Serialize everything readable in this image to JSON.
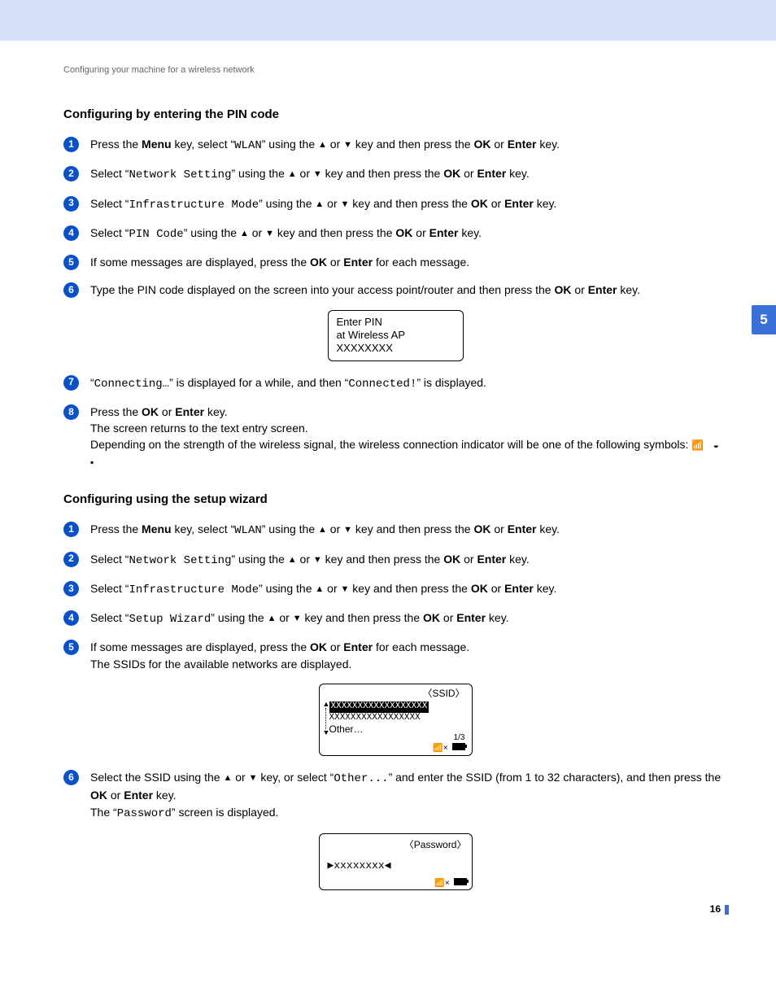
{
  "breadcrumb": "Configuring your machine for a wireless network",
  "chapter_tab": "5",
  "page_number": "16",
  "section_a": {
    "title": "Configuring by entering the PIN code",
    "steps": {
      "s1": {
        "pre": "Press the ",
        "b1": "Menu",
        "mid1": " key, select “",
        "mono": "WLAN",
        "mid2": "” using the ",
        "keys": " key and then press the ",
        "b2": "OK",
        "or": " or ",
        "b3": "Enter",
        "end": " key."
      },
      "s2": {
        "pre": "Select “",
        "mono": "Network Setting",
        "mid": "” using the ",
        "keys": " key and then press the ",
        "b2": "OK",
        "or": " or ",
        "b3": "Enter",
        "end": " key."
      },
      "s3": {
        "pre": "Select “",
        "mono": "Infrastructure Mode",
        "mid": "” using the ",
        "keys": " key and then press the ",
        "b2": "OK",
        "or": " or ",
        "b3": "Enter",
        "end": " key."
      },
      "s4": {
        "pre": "Select “",
        "mono": "PIN Code",
        "mid": "” using the ",
        "keys": " key and then press the ",
        "b2": "OK",
        "or": " or ",
        "b3": "Enter",
        "end": " key."
      },
      "s5": {
        "pre": "If some messages are displayed, press the ",
        "b2": "OK",
        "or": " or ",
        "b3": "Enter",
        "end": " for each message."
      },
      "s6": {
        "pre": "Type the PIN code displayed on the screen into your access point/router and then press the ",
        "b2": "OK",
        "or": " or ",
        "b3": "Enter",
        "end": " key."
      },
      "lcd1": {
        "l1": "Enter PIN",
        "l2": "at Wireless AP",
        "l3": "XXXXXXXX"
      },
      "s7": {
        "pre": "“",
        "mono1": "Connecting…",
        "mid": "” is displayed for a while, and then “",
        "mono2": "Connected!",
        "end": "” is displayed."
      },
      "s8": {
        "l1a": "Press the ",
        "b2": "OK",
        "or": " or ",
        "b3": "Enter",
        "l1b": " key.",
        "l2": "The screen returns to the text entry screen.",
        "l3": "Depending on the strength of the wireless signal, the wireless connection indicator will be one of the following symbols: "
      }
    }
  },
  "section_b": {
    "title": "Configuring using the setup wizard",
    "steps": {
      "s1": {
        "pre": "Press the ",
        "b1": "Menu",
        "mid1": " key, select “",
        "mono": "WLAN",
        "mid2": "” using the ",
        "keys": " key and then press the ",
        "b2": "OK",
        "or": " or ",
        "b3": "Enter",
        "end": " key."
      },
      "s2": {
        "pre": "Select “",
        "mono": "Network Setting",
        "mid": "” using the ",
        "keys": " key and then press the ",
        "b2": "OK",
        "or": " or ",
        "b3": "Enter",
        "end": " key."
      },
      "s3": {
        "pre": "Select “",
        "mono": "Infrastructure Mode",
        "mid": "” using the ",
        "keys": " key and then press the ",
        "b2": "OK",
        "or": " or ",
        "b3": "Enter",
        "end": " key."
      },
      "s4": {
        "pre": "Select “",
        "mono": "Setup Wizard",
        "mid": "” using the ",
        "keys": " key and then press the ",
        "b2": "OK",
        "or": " or ",
        "b3": "Enter",
        "end": " key."
      },
      "s5": {
        "l1a": "If some messages are displayed, press the ",
        "b2": "OK",
        "or": " or ",
        "b3": "Enter",
        "l1b": " for each message.",
        "l2": "The SSIDs for the available networks are displayed."
      },
      "lcd2": {
        "hdr": "〈SSID〉",
        "r1": "XXXXXXXXXXXXXXXXXX",
        "r2": "XXXXXXXXXXXXXXXXX",
        "r3": "Other…",
        "foot_page": "1/3"
      },
      "s6": {
        "l1a": "Select the SSID using the ",
        "l1b": " key, or select “",
        "mono": "Other...",
        "l1c": "” and enter the SSID (from 1 to 32 characters), and then press the ",
        "b2": "OK",
        "or": " or ",
        "b3": "Enter",
        "l1d": " key.",
        "l2a": "The “",
        "mono2": "Password",
        "l2b": "” screen is displayed."
      },
      "lcd3": {
        "hdr": "〈Password〉",
        "val": "▶xxxxxxxx◀"
      }
    }
  }
}
